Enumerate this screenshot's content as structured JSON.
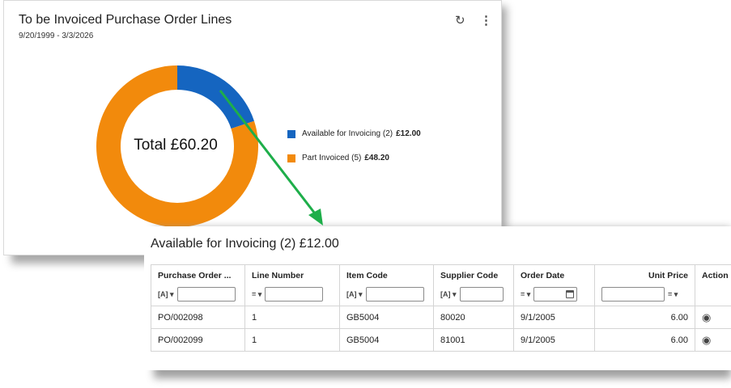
{
  "widget": {
    "title": "To be Invoiced Purchase Order Lines",
    "date_range": "9/20/1999 - 3/3/2026",
    "refresh_icon": "refresh-icon",
    "more_icon": "more-vertical-icon",
    "center_label": "Total £60.20"
  },
  "chart_data": {
    "type": "pie",
    "variant": "donut",
    "total": 60.2,
    "slices": [
      {
        "label": "Available for Invoicing (2)",
        "value": 12.0,
        "amount_text": "£12.00",
        "color": "#1565c0"
      },
      {
        "label": "Part Invoiced (5)",
        "value": 48.2,
        "amount_text": "£48.20",
        "color": "#f28a0c"
      }
    ],
    "legend_position": "right"
  },
  "annotation": {
    "arrow_color": "#1eae4a"
  },
  "grid": {
    "title": "Available for Invoicing (2) £12.00",
    "columns": [
      {
        "label": "Purchase Order ...",
        "operator": "[A] ▾",
        "filter_value": ""
      },
      {
        "label": "Line Number",
        "operator": "= ▾",
        "filter_value": ""
      },
      {
        "label": "Item Code",
        "operator": "[A] ▾",
        "filter_value": ""
      },
      {
        "label": "Supplier Code",
        "operator": "[A] ▾",
        "filter_value": ""
      },
      {
        "label": "Order Date",
        "operator": "= ▾",
        "filter_value": ""
      },
      {
        "label": "Unit Price",
        "operator": "= ▾",
        "filter_value": ""
      },
      {
        "label": "Action"
      }
    ],
    "rows": [
      [
        "PO/002098",
        "1",
        "GB5004",
        "80020",
        "9/1/2005",
        "6.00",
        "view-icon"
      ],
      [
        "PO/002099",
        "1",
        "GB5004",
        "81001",
        "9/1/2005",
        "6.00",
        "view-icon"
      ]
    ]
  }
}
